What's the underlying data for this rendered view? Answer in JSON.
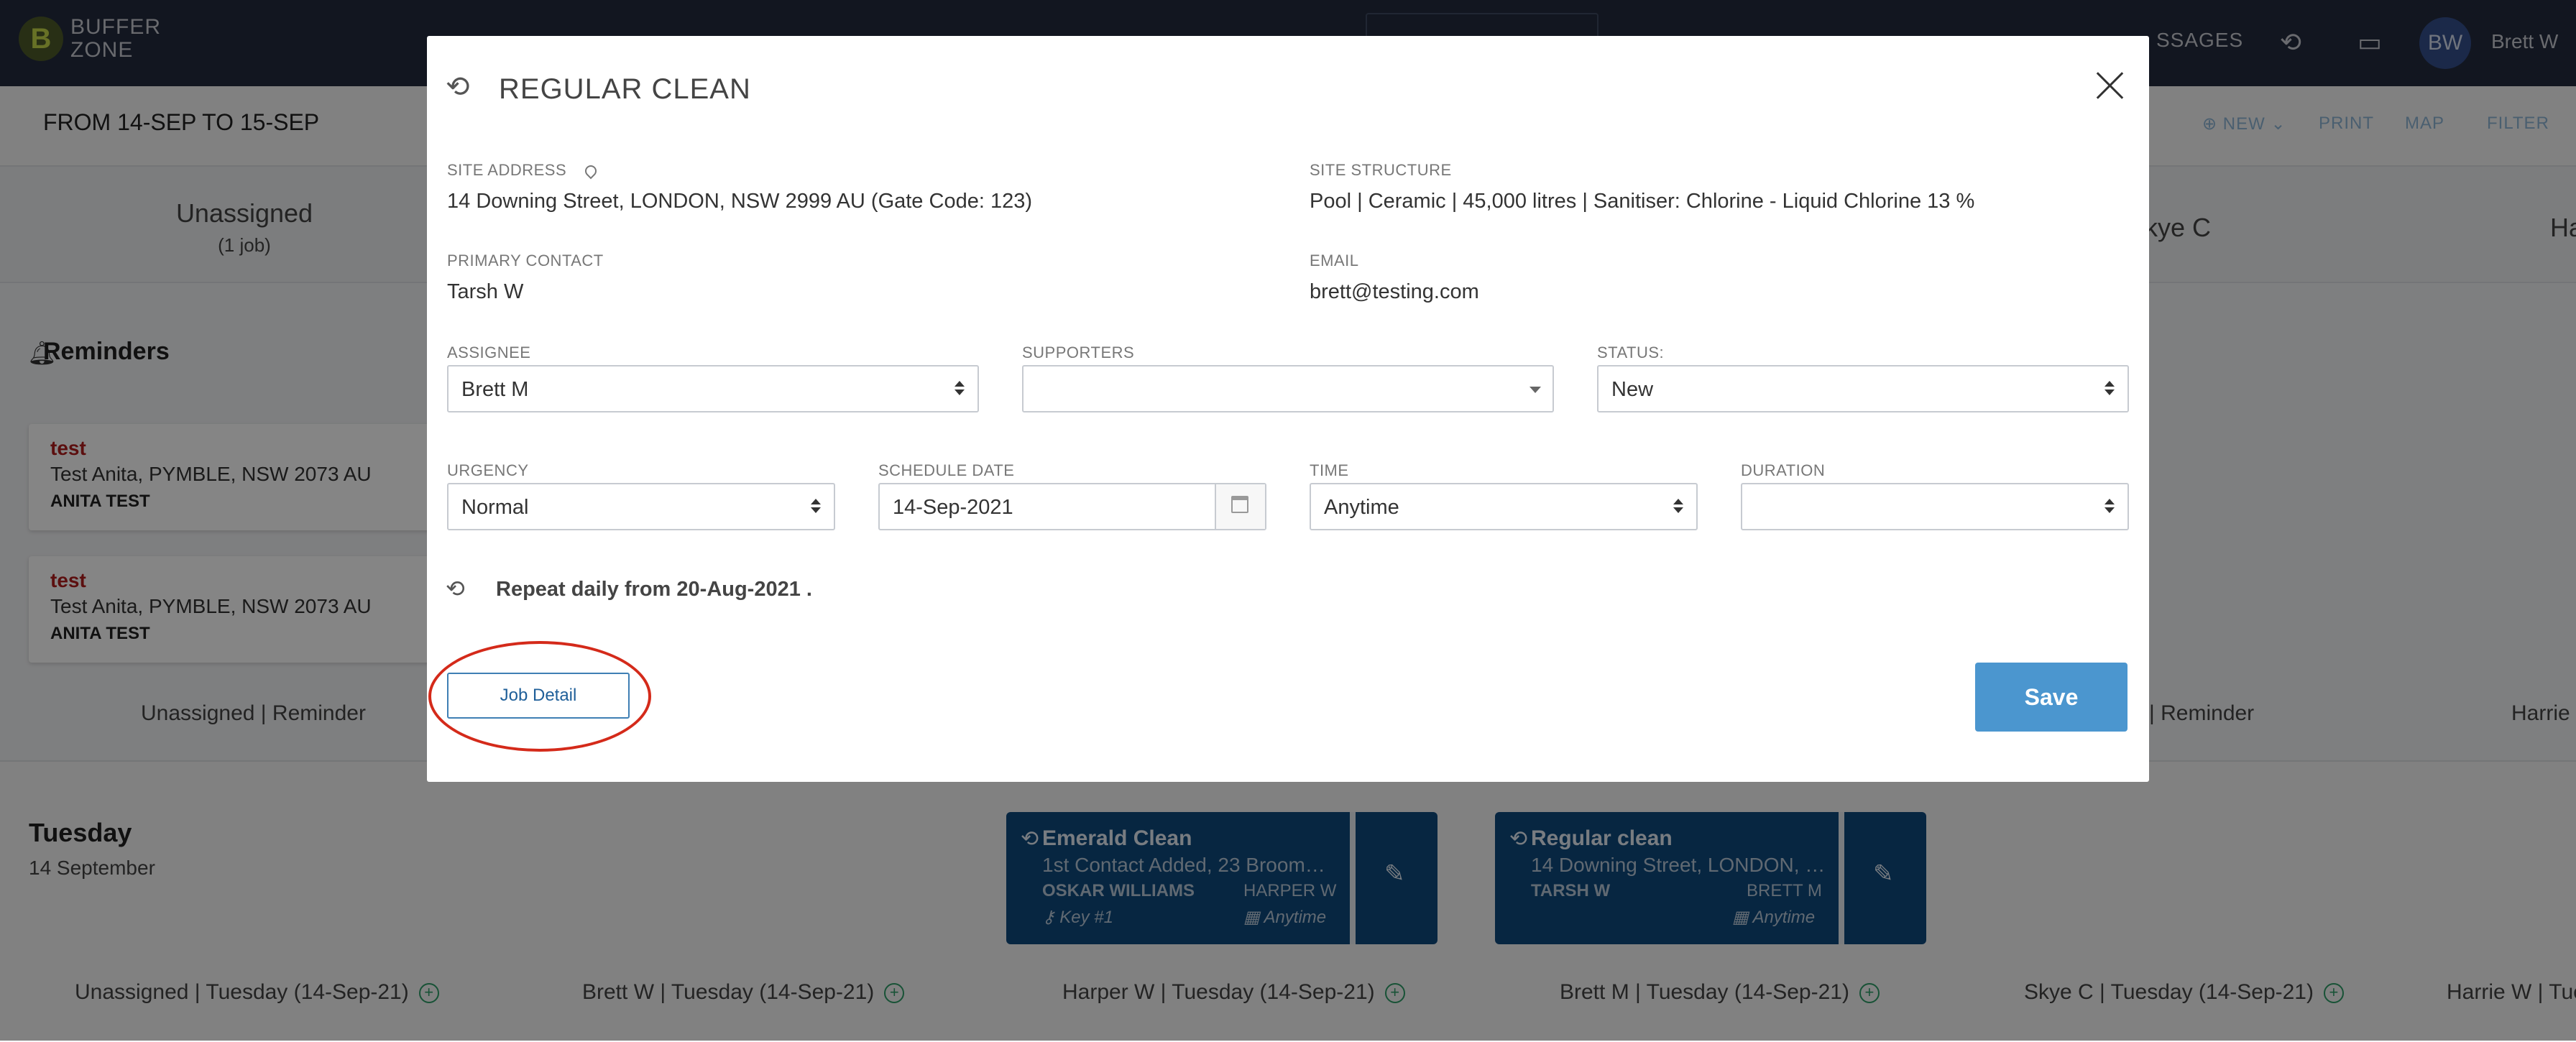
{
  "app": {
    "logo_mark": "B",
    "logo_line1": "BUFFER",
    "logo_line2": "ZONE",
    "top_messages": "SSAGES",
    "avatar_initials": "BW",
    "user_name": "Brett W"
  },
  "page": {
    "date_range": "FROM 14-SEP TO 15-SEP",
    "actions": {
      "new": "NEW",
      "print": "PRINT",
      "map": "MAP",
      "filter": "FILTER"
    },
    "columns": [
      {
        "name": "Unassigned",
        "sub": "(1 job)"
      },
      {
        "name": "kye C",
        "sub": ""
      },
      {
        "name": "Ha",
        "sub": ""
      }
    ],
    "reminders_title": "Reminders",
    "reminder_cards": [
      {
        "title": "test",
        "address": "Test Anita, PYMBLE, NSW 2073 AU",
        "contact": "ANITA TEST"
      },
      {
        "title": "test",
        "address": "Test Anita, PYMBLE, NSW 2073 AU",
        "contact": "ANITA TEST"
      }
    ],
    "reminder_lanes": [
      "Unassigned | Reminder",
      "| Reminder",
      "Harrie W"
    ],
    "day": {
      "title": "Tuesday",
      "subtitle": "14 September"
    },
    "jobs": [
      {
        "title": "Emerald Clean",
        "address": "1st Contact Added, 23 Broom…",
        "contact": "OSKAR WILLIAMS",
        "assignee": "HARPER W",
        "key": "Key #1",
        "time": "Anytime"
      },
      {
        "title": "Regular clean",
        "address": "14 Downing Street, LONDON, …",
        "contact": "TARSH W",
        "assignee": "BRETT M",
        "key": "",
        "time": "Anytime"
      }
    ],
    "day_lanes": [
      "Unassigned | Tuesday (14-Sep-21)",
      "Brett W | Tuesday (14-Sep-21)",
      "Harper W | Tuesday (14-Sep-21)",
      "Brett M | Tuesday (14-Sep-21)",
      "Skye C | Tuesday (14-Sep-21)",
      "Harrie W | Tues"
    ]
  },
  "modal": {
    "title": "REGULAR CLEAN",
    "site_address": {
      "label": "SITE ADDRESS",
      "value": "14 Downing Street, LONDON, NSW 2999 AU (Gate Code: 123)"
    },
    "site_structure": {
      "label": "SITE STRUCTURE",
      "value": "Pool | Ceramic | 45,000 litres | Sanitiser: Chlorine - Liquid Chlorine 13 %"
    },
    "primary_contact": {
      "label": "PRIMARY CONTACT",
      "value": "Tarsh W"
    },
    "email": {
      "label": "EMAIL",
      "value": "brett@testing.com"
    },
    "assignee": {
      "label": "ASSIGNEE",
      "value": "Brett M"
    },
    "supporters": {
      "label": "SUPPORTERS",
      "value": ""
    },
    "status": {
      "label": "STATUS:",
      "value": "New"
    },
    "urgency": {
      "label": "URGENCY",
      "value": "Normal"
    },
    "schedule_date": {
      "label": "SCHEDULE DATE",
      "value": "14-Sep-2021"
    },
    "time": {
      "label": "TIME",
      "value": "Anytime"
    },
    "duration": {
      "label": "DURATION",
      "value": ""
    },
    "repeat_text": "Repeat daily from 20-Aug-2021 .",
    "job_detail_button": "Job Detail",
    "save_button": "Save"
  }
}
